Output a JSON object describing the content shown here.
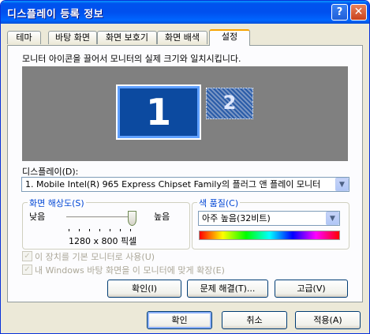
{
  "window": {
    "title": "디스플레이 등록 정보",
    "help_label": "?",
    "close_label": "✕"
  },
  "tabs": [
    {
      "label": "테마"
    },
    {
      "label": "바탕 화면"
    },
    {
      "label": "화면 보호기"
    },
    {
      "label": "화면 배색"
    },
    {
      "label": "설정"
    }
  ],
  "settings": {
    "instruction": "모니터 아이콘을 끌어서 모니터의 실제 크기와 일치시킵니다.",
    "monitor1_label": "1",
    "monitor2_label": "2",
    "display_label": "디스플레이(D):",
    "display_value": "1. Mobile Intel(R) 965 Express Chipset Family의 플러그 앤 플레이 모니터",
    "resolution": {
      "group_label": "화면 해상도(S)",
      "low_label": "낮음",
      "high_label": "높음",
      "value_text": "1280 x 800 픽셀",
      "slider_level": 1.0
    },
    "color": {
      "group_label": "색 품질(C)",
      "value": "아주 높음(32비트)"
    },
    "checkbox_primary": "이 장치를 기본 모니터로 사용(U)",
    "checkbox_extend": "내 Windows 바탕 화면을 이 모니터에 맞게 확장(E)",
    "identify_button": "확인(I)",
    "troubleshoot_button": "문제 해결(T)...",
    "advanced_button": "고급(V)"
  },
  "footer": {
    "ok_label": "확인",
    "cancel_label": "취소",
    "apply_label": "적용(A)"
  },
  "colors": {
    "title_blue": "#0053ee",
    "face": "#ece9d8",
    "monitor_primary": "#0c4aa0",
    "group_label": "#0046d5"
  }
}
